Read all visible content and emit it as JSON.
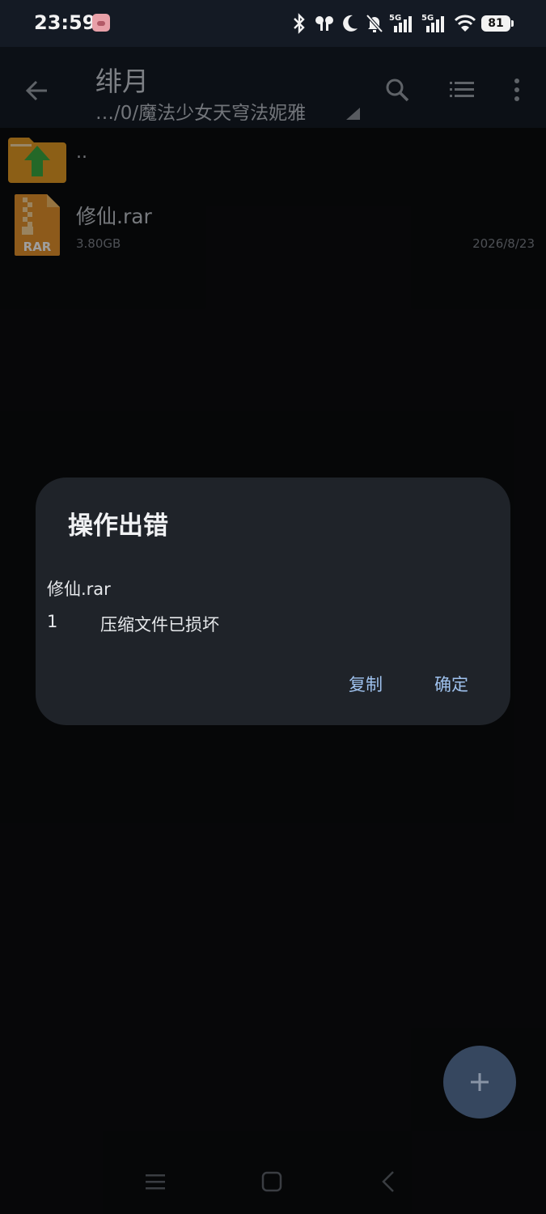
{
  "status_bar": {
    "time": "23:59",
    "battery": "81",
    "icons": [
      "avatar-icon",
      "bluetooth-icon",
      "earbuds-icon",
      "moon-icon",
      "bell-off-icon",
      "signal-5g-icon",
      "signal-5g-icon",
      "wifi-icon",
      "battery-icon"
    ]
  },
  "app_bar": {
    "title": "绯月",
    "path": "…/0/魔法少女天穹法妮雅",
    "icons": [
      "back-arrow-icon",
      "search-icon",
      "list-view-icon",
      "more-vert-icon"
    ]
  },
  "files": [
    {
      "name": "..",
      "icon": "folder-up-icon"
    },
    {
      "name": "修仙.rar",
      "size": "3.80GB",
      "date": "2026/8/23",
      "icon": "rar-file-icon",
      "icon_label": "RAR"
    }
  ],
  "dialog": {
    "title": "操作出错",
    "file": "修仙.rar",
    "error_code": "1",
    "error_message": "压缩文件已损坏",
    "copy_label": "复制",
    "ok_label": "确定"
  },
  "fab": {
    "icon": "plus-icon"
  },
  "nav_bar": {
    "icons": [
      "menu-icon",
      "home-icon",
      "back-icon"
    ]
  },
  "colors": {
    "background": "#0b0c0e",
    "bar": "#141a24",
    "dialog": "#1f2329",
    "accent": "#9fc2ee",
    "fab": "#36475f",
    "folder": "#e39a25",
    "arrow": "#3aa842",
    "rar": "#e4922c"
  }
}
